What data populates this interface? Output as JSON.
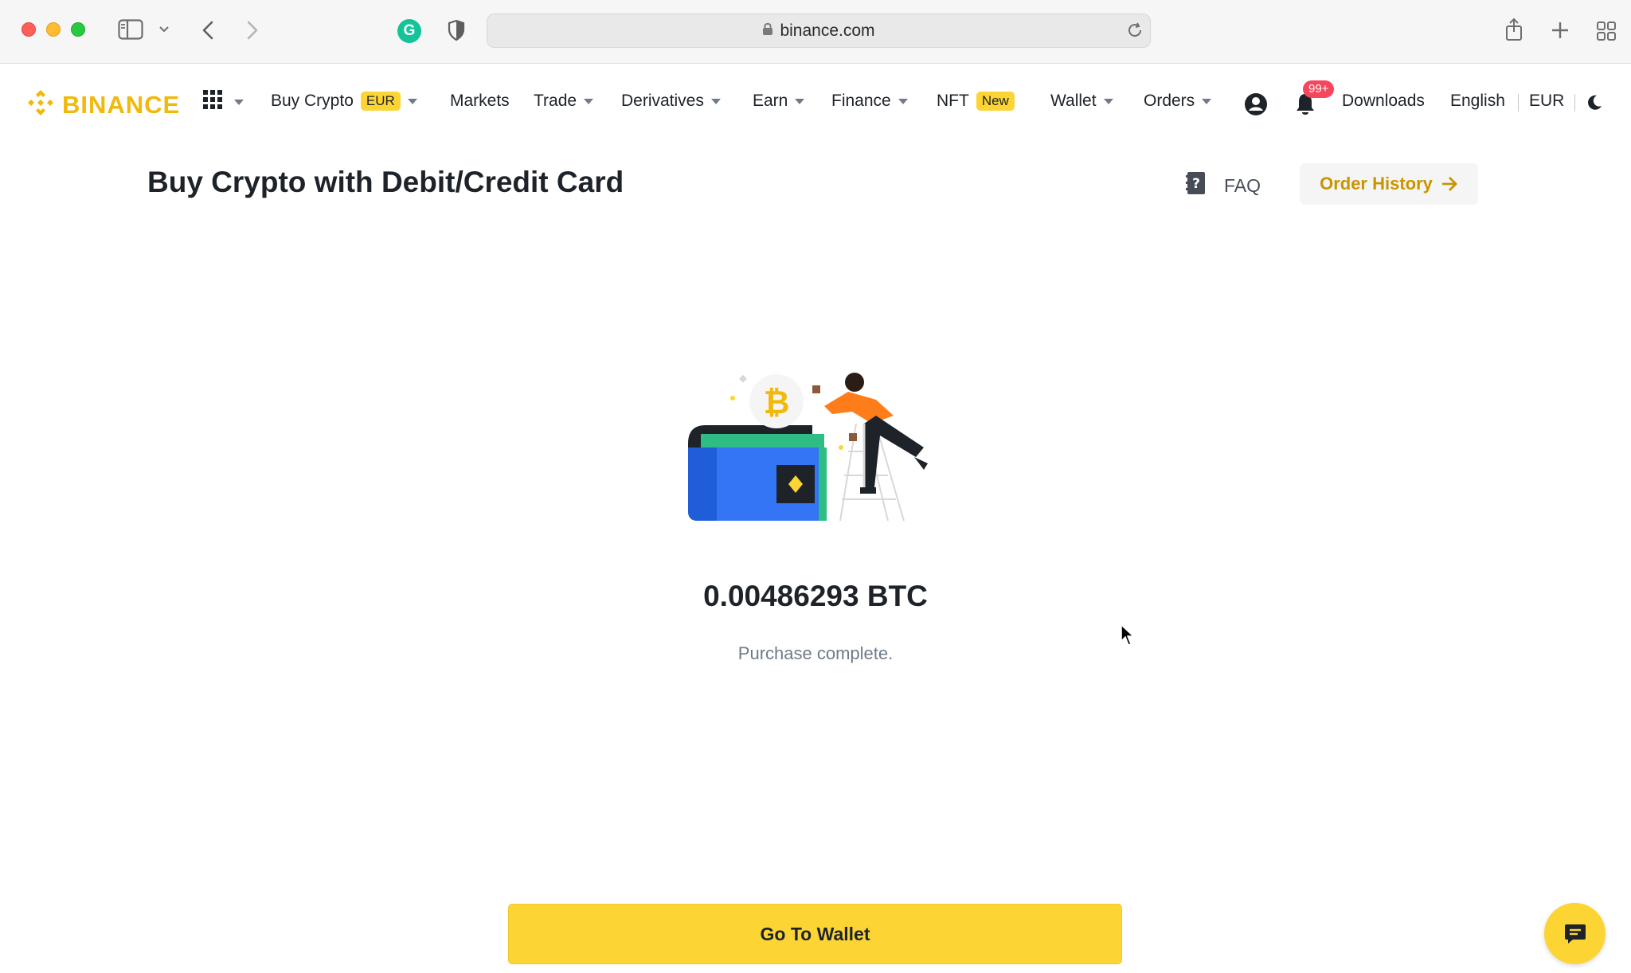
{
  "browser": {
    "url": "binance.com",
    "icons": [
      "sidebar-icon",
      "chevron-down-icon",
      "back-icon",
      "forward-icon",
      "grammarly-icon",
      "shield-icon",
      "lock-icon",
      "reload-icon",
      "share-icon",
      "new-tab-icon",
      "tab-overview-icon"
    ],
    "grammarly_letter": "G"
  },
  "nav": {
    "logo_text": "BINANCE",
    "buy_crypto": "Buy Crypto",
    "buy_crypto_badge": "EUR",
    "markets": "Markets",
    "trade": "Trade",
    "derivatives": "Derivatives",
    "earn": "Earn",
    "finance": "Finance",
    "nft": "NFT",
    "nft_badge": "New",
    "wallet": "Wallet",
    "orders": "Orders",
    "notification_count": "99+",
    "downloads": "Downloads",
    "language": "English",
    "currency": "EUR"
  },
  "page": {
    "title": "Buy Crypto with Debit/Credit Card",
    "faq_label": "FAQ",
    "order_history_label": "Order History",
    "amount": "0.00486293 BTC",
    "status": "Purchase complete.",
    "go_to_wallet_label": "Go To Wallet"
  },
  "colors": {
    "brand_yellow": "#FCD535",
    "brand_gold": "#F0B90B",
    "link_gold": "#C99400",
    "text_primary": "#1E2329",
    "text_secondary": "#707A8A",
    "badge_red": "#F6465D"
  }
}
